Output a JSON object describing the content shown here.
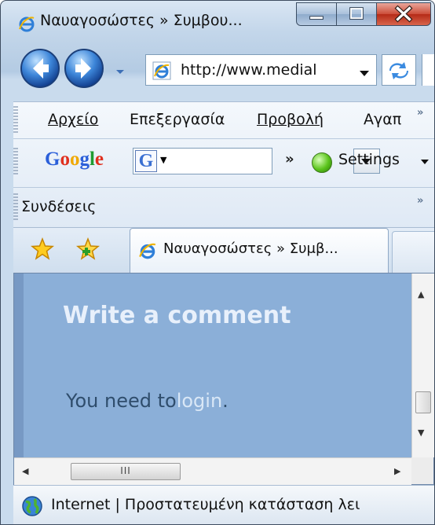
{
  "window": {
    "title": "Ναυαγοσώστες » Συμβου..."
  },
  "nav": {
    "address": "http://www.medial"
  },
  "menu": {
    "file": "Αρχείο",
    "edit": "Επεξεργασία",
    "view": "Προβολή",
    "favorites": "Αγαπ"
  },
  "google_toolbar": {
    "logo": "Google",
    "more": "»",
    "settings_label": "Settings"
  },
  "links_bar": {
    "label": "Συνδέσεις"
  },
  "tabs": [
    {
      "label": "Ναυαγοσώστες » Συμβ..."
    }
  ],
  "page": {
    "heading": "Write a comment",
    "need_prefix": "You need to",
    "login_link": "login",
    "need_suffix": ".",
    "hscroll_grip": "III"
  },
  "status": {
    "text": "Internet | Προστατευμένη κατάσταση λει"
  },
  "colors": {
    "page_bg": "#8bafd8",
    "heading": "#e8f0fb",
    "login_link": "#d9e7f6"
  },
  "icons": [
    "ie-icon",
    "back-icon",
    "forward-icon",
    "refresh-icon",
    "favorites-star-icon",
    "add-favorite-icon",
    "globe-icon",
    "close-icon",
    "minimize-icon",
    "maximize-icon"
  ]
}
